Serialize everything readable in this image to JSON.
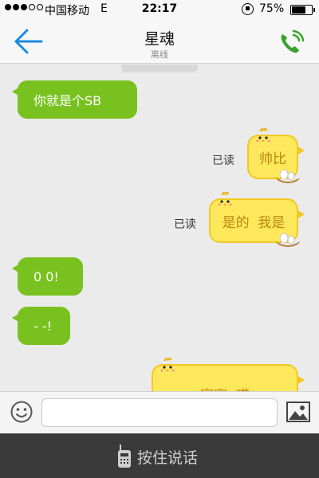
{
  "status_bar": {
    "signal_filled": 3,
    "signal_total": 5,
    "carrier": "中国移动",
    "network": "E",
    "time": "22:17",
    "battery_text": "75%",
    "battery_level": 0.75
  },
  "nav": {
    "title": "星魂",
    "subtitle": "离线",
    "accent_color": "#1a8ae5",
    "call_color": "#3aa32d"
  },
  "messages": [
    {
      "direction": "incoming",
      "style": "green",
      "text": "你就是个SB"
    },
    {
      "direction": "outgoing",
      "style": "yellow-chick",
      "text": "帅比",
      "read_label": "已读"
    },
    {
      "direction": "outgoing",
      "style": "yellow-chick",
      "text": "是的  我是",
      "read_label": "已读"
    },
    {
      "direction": "incoming",
      "style": "green",
      "text": "0 0!"
    },
    {
      "direction": "incoming",
      "style": "green",
      "text": "- -!"
    },
    {
      "direction": "outgoing",
      "style": "yellow-chick",
      "text": "寂寞  哎"
    }
  ],
  "input_bar": {
    "text_value": "",
    "emoji_icon": "smiley-icon",
    "image_icon": "image-icon"
  },
  "voice_bar": {
    "label": "按住说话",
    "icon": "walkie-talkie-icon"
  }
}
